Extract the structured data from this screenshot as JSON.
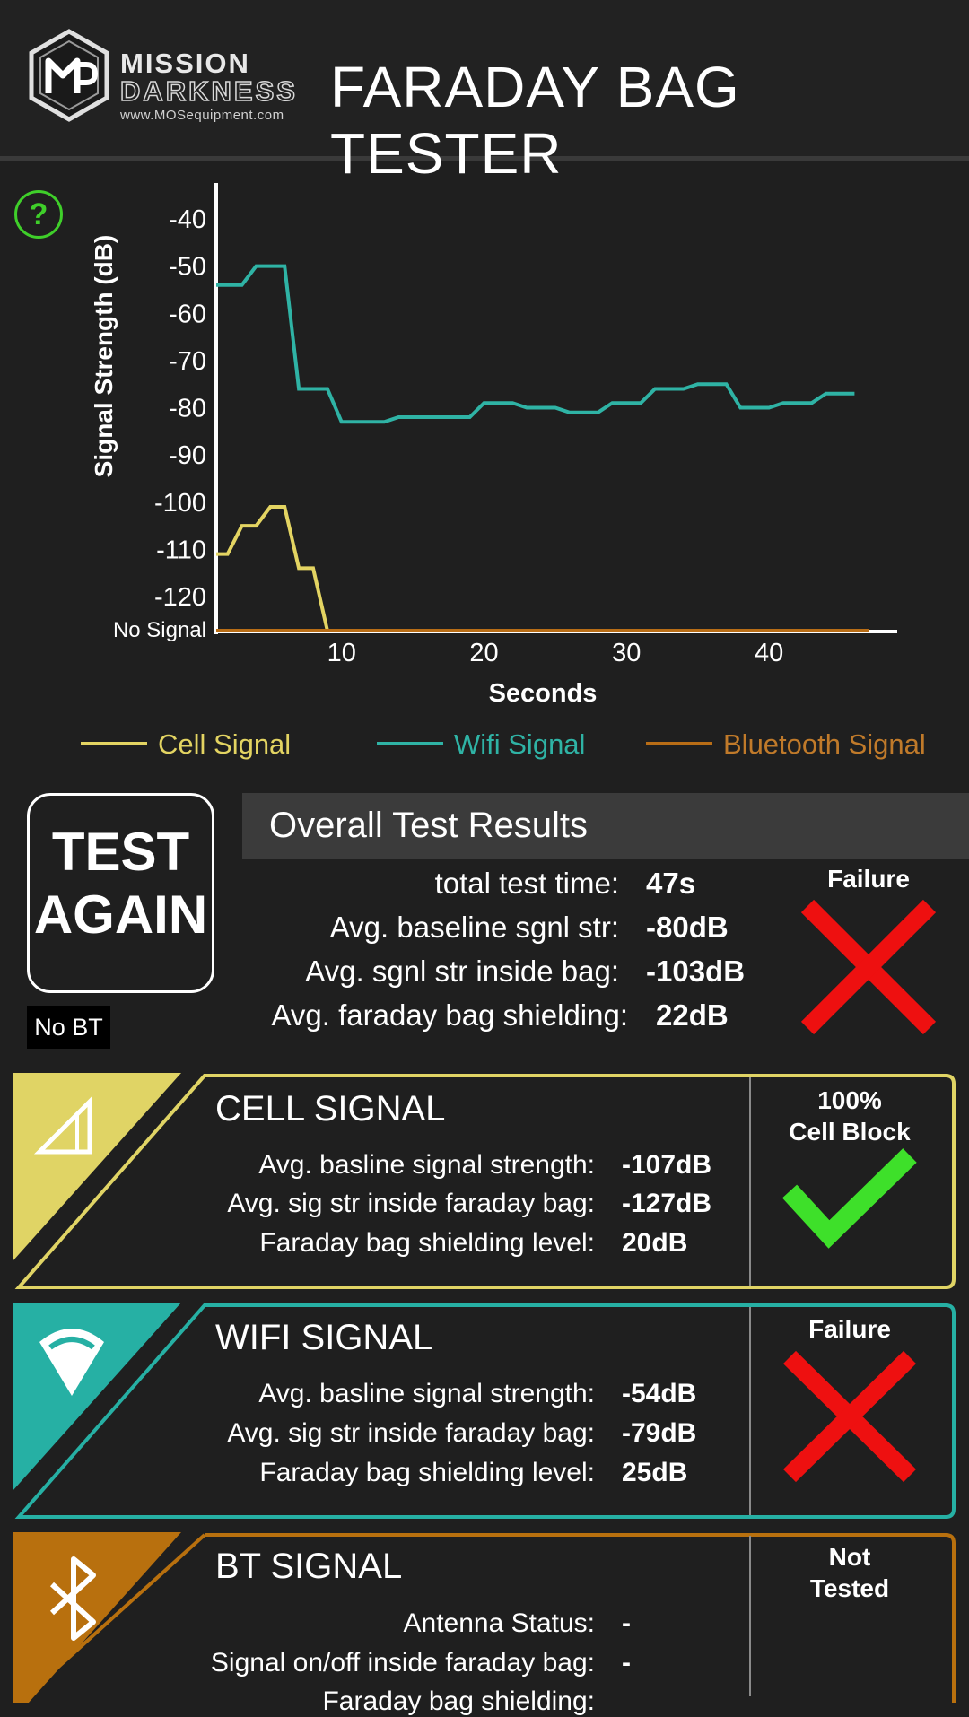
{
  "header": {
    "brand_line1": "MISSION",
    "brand_line2": "DARKNESS",
    "brand_url": "www.MOSequipment.com",
    "title": "FARADAY BAG TESTER"
  },
  "help_icon": "?",
  "chart_data": {
    "type": "line",
    "xlabel": "Seconds",
    "ylabel": "Signal Strength (dB)",
    "x_ticks": [
      10,
      20,
      30,
      40
    ],
    "y_ticks": [
      {
        "value": -40,
        "label": "-40"
      },
      {
        "value": -50,
        "label": "-50"
      },
      {
        "value": -60,
        "label": "-60"
      },
      {
        "value": -70,
        "label": "-70"
      },
      {
        "value": -80,
        "label": "-80"
      },
      {
        "value": -90,
        "label": "-90"
      },
      {
        "value": -100,
        "label": "-100"
      },
      {
        "value": -110,
        "label": "-110"
      },
      {
        "value": -120,
        "label": "-120"
      },
      {
        "value": -127.5,
        "label": "No Signal"
      }
    ],
    "xlim": [
      1.2,
      49
    ],
    "ylim": [
      -127.5,
      -30
    ],
    "series": [
      {
        "name": "Cell Signal",
        "color": "#e3d462",
        "points": [
          [
            1.2,
            -111
          ],
          [
            2,
            -111
          ],
          [
            3,
            -105
          ],
          [
            4,
            -105
          ],
          [
            5,
            -101
          ],
          [
            6,
            -101
          ],
          [
            7,
            -114
          ],
          [
            8,
            -114
          ],
          [
            9,
            -127.5
          ],
          [
            47,
            -127.5
          ]
        ]
      },
      {
        "name": "Wifi Signal",
        "color": "#2fb3a5",
        "points": [
          [
            1.2,
            -54
          ],
          [
            3,
            -54
          ],
          [
            4,
            -50
          ],
          [
            6,
            -50
          ],
          [
            7,
            -76
          ],
          [
            9,
            -76
          ],
          [
            10,
            -83
          ],
          [
            13,
            -83
          ],
          [
            14,
            -82
          ],
          [
            19,
            -82
          ],
          [
            20,
            -79
          ],
          [
            22,
            -79
          ],
          [
            23,
            -80
          ],
          [
            25,
            -80
          ],
          [
            26,
            -81
          ],
          [
            28,
            -81
          ],
          [
            29,
            -79
          ],
          [
            31,
            -79
          ],
          [
            32,
            -76
          ],
          [
            34,
            -76
          ],
          [
            35,
            -75
          ],
          [
            37,
            -75
          ],
          [
            38,
            -80
          ],
          [
            40,
            -80
          ],
          [
            41,
            -79
          ],
          [
            43,
            -79
          ],
          [
            44,
            -77
          ],
          [
            46,
            -77
          ]
        ]
      },
      {
        "name": "Bluetooth Signal",
        "color": "#b86d16",
        "points": [
          [
            1.2,
            -127.5
          ],
          [
            47,
            -127.5
          ]
        ]
      }
    ],
    "legend_position": "bottom",
    "grid": false
  },
  "legend": {
    "cell": "Cell Signal",
    "wifi": "Wifi Signal",
    "bt": "Bluetooth Signal"
  },
  "test_again": {
    "line1": "TEST",
    "line2": "AGAIN"
  },
  "no_bt_badge": "No BT",
  "overall": {
    "title": "Overall Test Results",
    "rows": [
      {
        "label": "total test time:",
        "value": "47s"
      },
      {
        "label": "Avg. baseline sgnl str:",
        "value": "-80dB"
      },
      {
        "label": "Avg. sgnl str inside bag:",
        "value": "-103dB"
      },
      {
        "label": "Avg. faraday bag shielding:",
        "value": "22dB"
      }
    ],
    "status": "Failure",
    "status_icon": "red-x-icon"
  },
  "sections": {
    "cell": {
      "title": "CELL SIGNAL",
      "color": "#e0d465",
      "rows": [
        {
          "label": "Avg. basline signal strength:",
          "value": "-107dB"
        },
        {
          "label": "Avg. sig str inside faraday bag:",
          "value": "-127dB"
        },
        {
          "label": "Faraday bag shielding level:",
          "value": "20dB"
        }
      ],
      "status_line1": "100%",
      "status_line2": "Cell Block",
      "status_icon": "green-check-icon"
    },
    "wifi": {
      "title": "WIFI SIGNAL",
      "color": "#26b0a4",
      "rows": [
        {
          "label": "Avg. basline signal strength:",
          "value": "-54dB"
        },
        {
          "label": "Avg. sig str inside faraday bag:",
          "value": "-79dB"
        },
        {
          "label": "Faraday bag shielding level:",
          "value": "25dB"
        }
      ],
      "status_line1": "Failure",
      "status_icon": "red-x-icon"
    },
    "bt": {
      "title": "BT SIGNAL",
      "color": "#b8700e",
      "rows": [
        {
          "label": "Antenna Status:",
          "value": "-"
        },
        {
          "label": "Signal on/off inside faraday bag:",
          "value": "-"
        },
        {
          "label": "Faraday bag shielding:",
          "value": ""
        }
      ],
      "status_line1": "Not",
      "status_line2": "Tested"
    }
  }
}
